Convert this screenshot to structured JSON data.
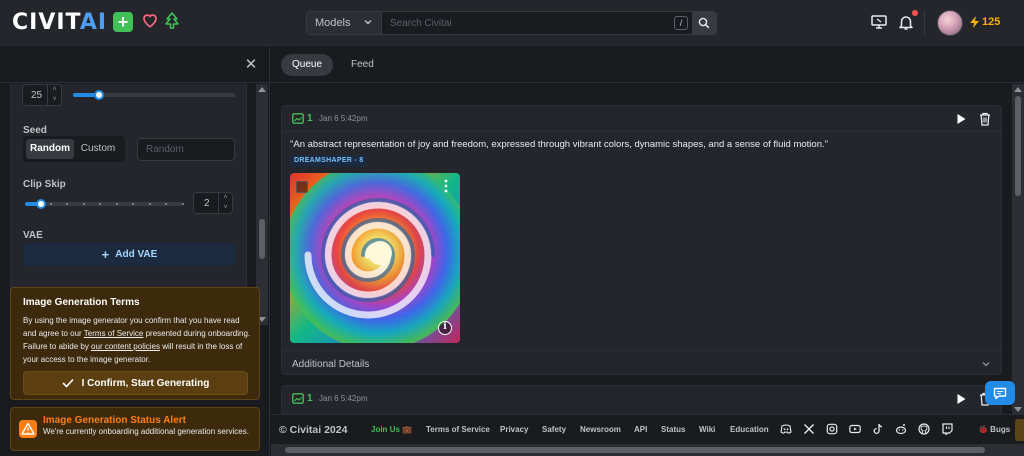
{
  "header": {
    "logo_main": "CIVIT",
    "logo_ai": "AI",
    "search_type": "Models",
    "search_placeholder": "Search Civitai",
    "search_shortcut": "/",
    "buzz_amount": "125",
    "accent_color": "#228be6"
  },
  "left_panel": {
    "steps_value": "25",
    "steps_slider_level": 0.16,
    "seed_label": "Seed",
    "seed_modes": [
      "Random",
      "Custom"
    ],
    "seed_active": "Random",
    "seed_placeholder": "Random",
    "clip_skip_label": "Clip Skip",
    "clip_skip_value": "2",
    "clip_skip_slider_level": 0.1,
    "vae_label": "VAE",
    "add_vae_label": "Add VAE"
  },
  "terms": {
    "title": "Image Generation Terms",
    "text_a": "By using the image generator you confirm that you have read and agree to our ",
    "link_tos": "Terms of Service",
    "text_b": " presented during onboarding. Failure to abide by ",
    "link_policies": "our content policies",
    "text_c": " will result in the loss of your access to the image generator.",
    "confirm_label": "I Confirm, Start Generating"
  },
  "alert": {
    "title": "Image Generation Status Alert",
    "text": "We're currently onboarding additional generation services."
  },
  "tabs": [
    "Queue",
    "Feed"
  ],
  "queue": [
    {
      "count": "1",
      "time": "Jan 6 5:42pm",
      "prompt": "\"An abstract representation of joy and freedom, expressed through vibrant colors, dynamic shapes, and a sense of fluid motion.\"",
      "model": "DREAMSHAPER - 8",
      "details_label": "Additional Details"
    },
    {
      "count": "1",
      "time": "Jan 6 5:42pm"
    }
  ],
  "footer": {
    "copyright": "© Civitai 2024",
    "links": [
      "Join Us 💼",
      "Terms of Service",
      "Privacy",
      "Safety",
      "Newsroom",
      "API",
      "Status",
      "Wiki",
      "Education"
    ],
    "bugs": "🐞 Bugs"
  }
}
